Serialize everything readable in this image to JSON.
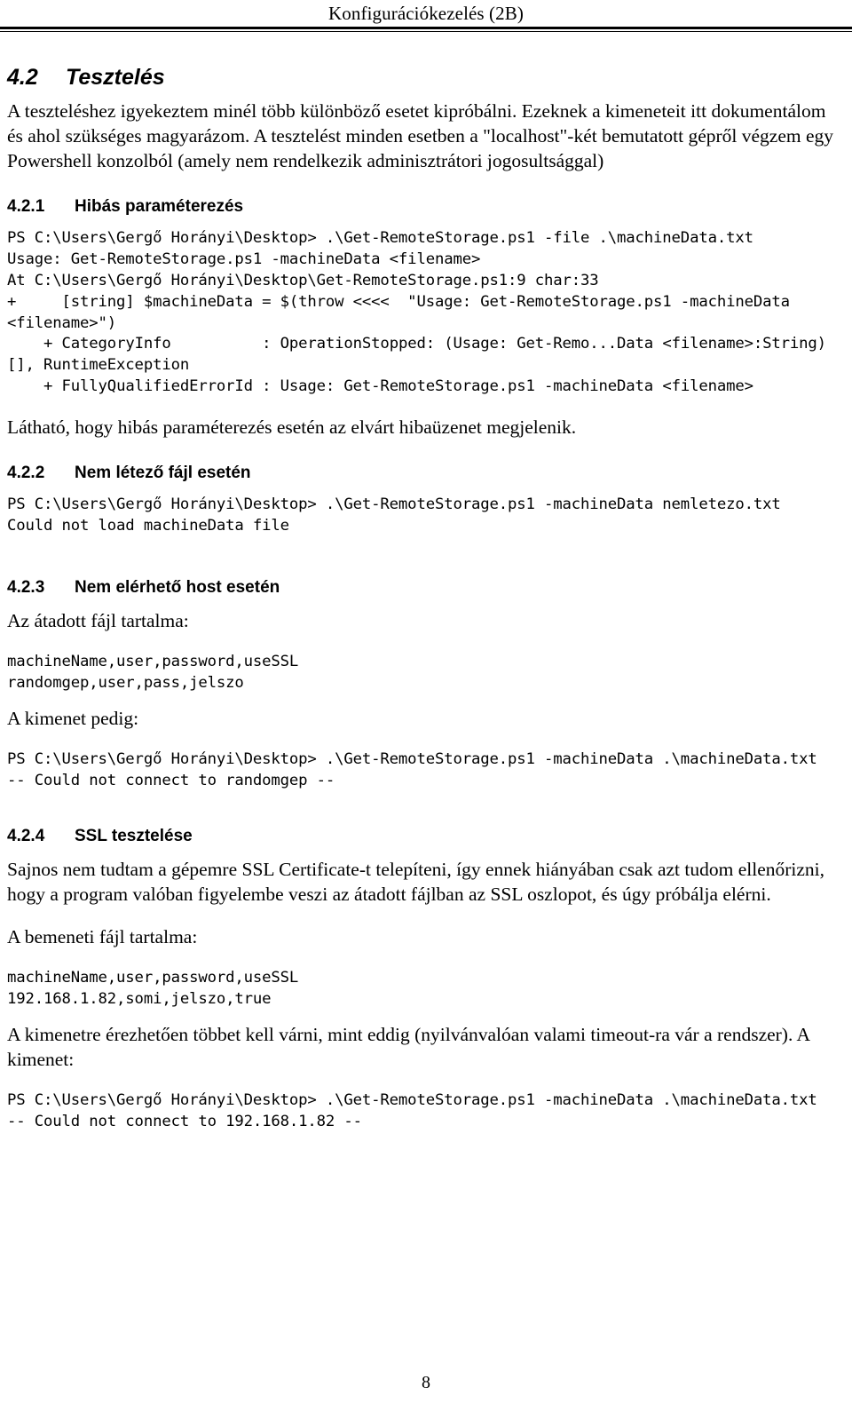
{
  "header": {
    "title": "Konfigurációkezelés (2B)"
  },
  "footer": {
    "page_number": "8"
  },
  "sections": {
    "main": {
      "number": "4.2",
      "title": "Tesztelés",
      "intro": "A teszteléshez igyekeztem minél több különböző esetet kipróbálni. Ezeknek a kimeneteit itt dokumentálom és ahol szükséges magyarázom. A tesztelést minden esetben a \"localhost\"-két bemutatott gépről végzem egy Powershell konzolból (amely nem rendelkezik adminisztrátori jogosultsággal)"
    },
    "s421": {
      "number": "4.2.1",
      "title": "Hibás paraméterezés",
      "console": "PS C:\\Users\\Gergő Horányi\\Desktop> .\\Get-RemoteStorage.ps1 -file .\\machineData.txt\nUsage: Get-RemoteStorage.ps1 -machineData <filename>\nAt C:\\Users\\Gergő Horányi\\Desktop\\Get-RemoteStorage.ps1:9 char:33\n+     [string] $machineData = $(throw <<<<  \"Usage: Get-RemoteStorage.ps1 -machineData <filename>\")\n    + CategoryInfo          : OperationStopped: (Usage: Get-Remo...Data <filename>:String) [], RuntimeException\n    + FullyQualifiedErrorId : Usage: Get-RemoteStorage.ps1 -machineData <filename>",
      "after": "Látható, hogy hibás paraméterezés esetén az elvárt hibaüzenet megjelenik."
    },
    "s422": {
      "number": "4.2.2",
      "title": "Nem létező fájl esetén",
      "console": "PS C:\\Users\\Gergő Horányi\\Desktop> .\\Get-RemoteStorage.ps1 -machineData nemletezo.txt\nCould not load machineData file"
    },
    "s423": {
      "number": "4.2.3",
      "title": "Nem elérhető host esetén",
      "input_label": "Az átadott fájl tartalma:",
      "input_file": "machineName,user,password,useSSL\nrandomgep,user,pass,jelszo",
      "output_label": "A kimenet pedig:",
      "console": "PS C:\\Users\\Gergő Horányi\\Desktop> .\\Get-RemoteStorage.ps1 -machineData .\\machineData.txt\n-- Could not connect to randomgep --"
    },
    "s424": {
      "number": "4.2.4",
      "title": "SSL tesztelése",
      "para1": "Sajnos nem tudtam a gépemre SSL Certificate-t telepíteni, így ennek hiányában csak azt tudom ellenőrizni, hogy a program valóban figyelembe veszi az átadott fájlban az SSL oszlopot, és úgy próbálja elérni.",
      "input_label": "A bemeneti fájl tartalma:",
      "input_file": "machineName,user,password,useSSL\n192.168.1.82,somi,jelszo,true",
      "para2": "A kimenetre érezhetően többet kell várni, mint eddig (nyilvánvalóan valami timeout-ra vár a rendszer). A kimenet:",
      "console": "PS C:\\Users\\Gergő Horányi\\Desktop> .\\Get-RemoteStorage.ps1 -machineData .\\machineData.txt\n-- Could not connect to 192.168.1.82 --"
    }
  }
}
